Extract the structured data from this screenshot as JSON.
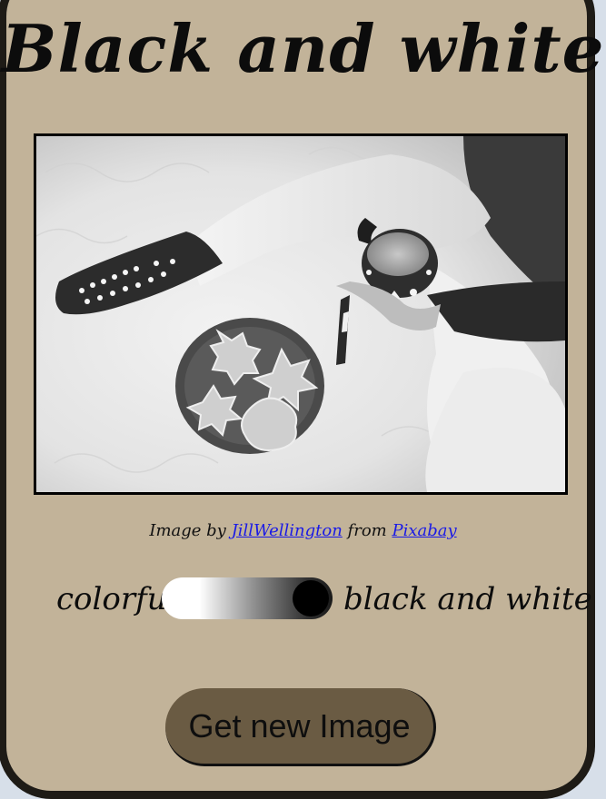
{
  "page": {
    "title": "Black and white"
  },
  "photo": {
    "description_icon": "black-and-white-photo",
    "credit_prefix": "Image by",
    "credit_author": "JillWellington",
    "credit_middle": "from",
    "credit_source": "Pixabay"
  },
  "toggle": {
    "left_label": "colorful",
    "right_label": "black and white",
    "state": "black and white"
  },
  "actions": {
    "new_image_label": "Get new Image"
  },
  "colors": {
    "card_background": "#c2b399",
    "card_border": "#1e1b16",
    "button_background": "#6a5b43",
    "link": "#1a1ae6"
  }
}
